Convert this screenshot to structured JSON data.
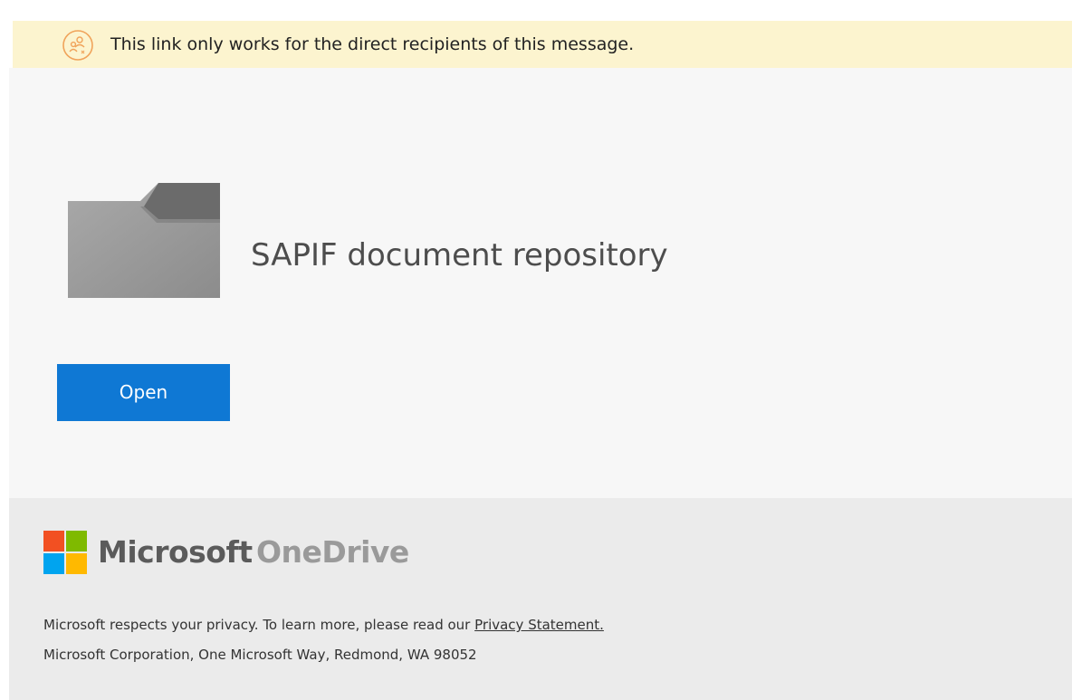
{
  "notice": {
    "icon": "people-link-icon",
    "text": "This link only works for the direct recipients of this message."
  },
  "item": {
    "icon": "folder-icon",
    "title": "SAPIF document repository",
    "open_label": "Open"
  },
  "footer": {
    "logo": "microsoft-logo-icon",
    "brand_microsoft": "Microsoft",
    "brand_product": "OneDrive",
    "privacy_prefix": "Microsoft respects your privacy. To learn more, please read our ",
    "privacy_link": "Privacy Statement.",
    "address": "Microsoft Corporation, One Microsoft Way, Redmond, WA 98052"
  },
  "colors": {
    "notice_bg": "#fcf4cf",
    "notice_icon": "#f0a35a",
    "content_bg": "#f7f7f7",
    "button_bg": "#0f78d4",
    "footer_bg": "#ebebeb",
    "logo_red": "#f25022",
    "logo_green": "#7fba00",
    "logo_blue": "#00a4ef",
    "logo_yellow": "#ffb900"
  }
}
